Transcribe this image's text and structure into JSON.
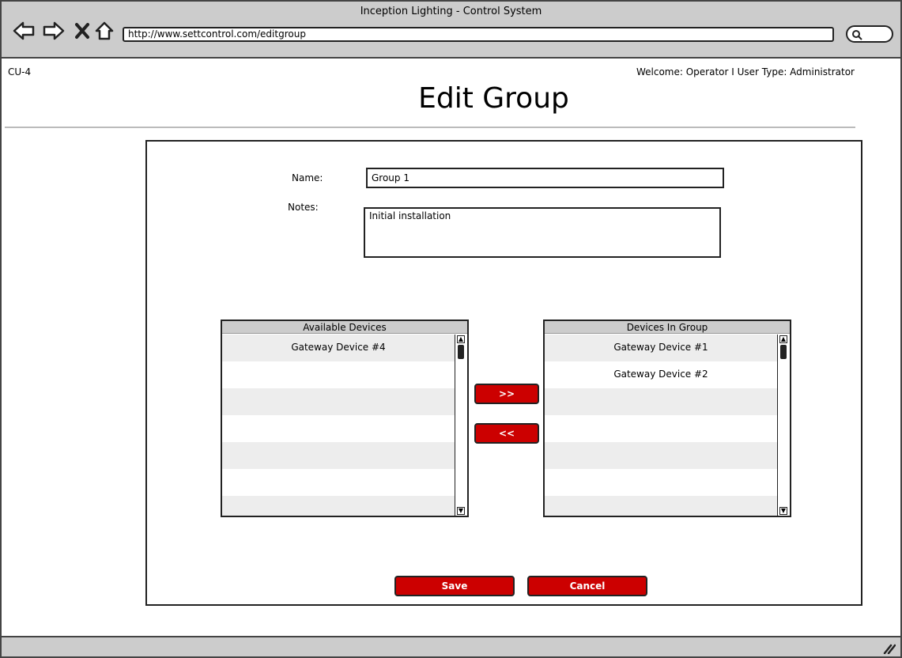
{
  "window": {
    "title": "Inception Lighting - Control System",
    "url": "http://www.settcontrol.com/editgroup"
  },
  "header": {
    "page_id": "CU-4",
    "welcome": "Welcome: Operator I User Type: Administrator",
    "title": "Edit Group"
  },
  "form": {
    "name_label": "Name:",
    "name_value": "Group 1",
    "notes_label": "Notes:",
    "notes_value": "Initial installation"
  },
  "available": {
    "header": "Available Devices",
    "items": [
      "Gateway Device #4",
      "",
      "",
      "",
      "",
      "",
      ""
    ]
  },
  "in_group": {
    "header": "Devices In Group",
    "items": [
      "Gateway Device #1",
      "Gateway Device #2",
      "",
      "",
      "",
      "",
      ""
    ]
  },
  "buttons": {
    "add": ">>",
    "remove": "<<",
    "save": "Save",
    "cancel": "Cancel"
  },
  "colors": {
    "accent": "#cc0000",
    "chrome": "#cccccc",
    "row_alt": "#ededed"
  }
}
